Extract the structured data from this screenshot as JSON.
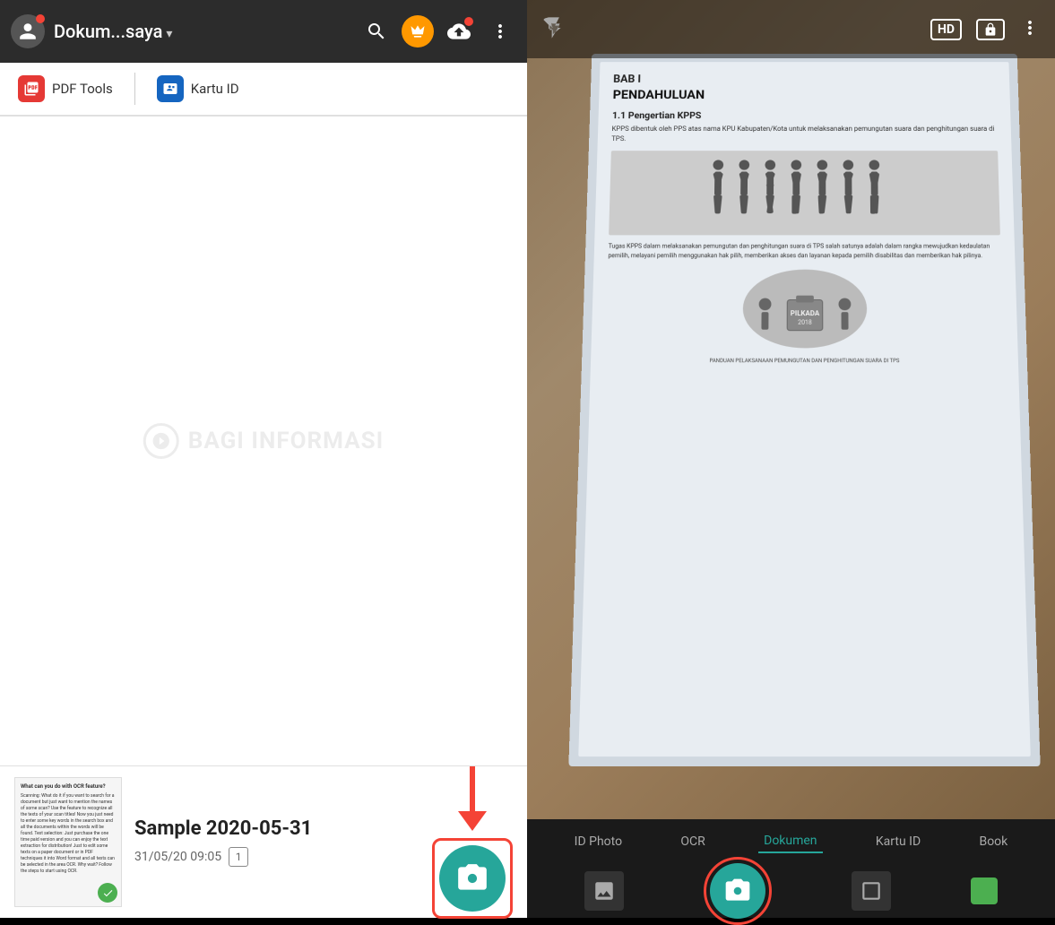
{
  "app": {
    "title": "Dokum...saya",
    "title_arrow": "▾"
  },
  "left_panel": {
    "toolbar": {
      "pdf_tools_label": "PDF Tools",
      "kartu_id_label": "Kartu ID"
    },
    "document": {
      "name": "Sample 2020-05-31",
      "date": "31/05/20 09:05",
      "pages": "1",
      "thumbnail_title": "What can you do with OCR feature?",
      "thumbnail_body": "Scanning: What do it if you want to search for a document but just want to mention the names of some scan? Use the feature to recognize all the texts of your scan titles! Now you just need to enter some key words in the search box and all the documents within the words will be found. Text selection: Just purchase the one time paid version and you can enjoy the text extraction for distribution! Just to edit some texts on a paper document or in PDF techniques it into Word format and all texts can be selected in the area OCR. Why wait? Follow the steps to start using OCR."
    }
  },
  "right_panel": {
    "camera": {
      "hd_label": "HD",
      "more_label": "⋮"
    },
    "mode_tabs": [
      {
        "label": "ID Photo",
        "active": false
      },
      {
        "label": "OCR",
        "active": false
      },
      {
        "label": "Dokumen",
        "active": true
      },
      {
        "label": "Kartu ID",
        "active": false
      },
      {
        "label": "Book",
        "active": false
      }
    ],
    "document_content": {
      "chapter": "BAB I",
      "chapter_title": "PENDAHULUAN",
      "section1_title": "1.1 Pengertian KPPS",
      "section1_body": "KPPS dibentuk oleh PPS atas nama KPU Kabupaten/Kota untuk melaksanakan pemungutan suara dan penghitungan suara di TPS.",
      "section2_body": "Tugas KPPS dalam melaksanakan pemungutan dan penghitungan suara di TPS salah satunya adalah dalam rangka mewujudkan kedaulatan pemilih, melayani pemilih menggunakan hak pilih, memberikan akses dan layanan kepada pemilih disabilitas dan memberikan hak pilinya.",
      "footer": "PANDUAN PELAKSANAAN PEMUNGUTAN DAN PENGHITUNGAN SUARA DI TPS"
    },
    "watermark": {
      "text": "BAGI INFORMASI"
    }
  }
}
